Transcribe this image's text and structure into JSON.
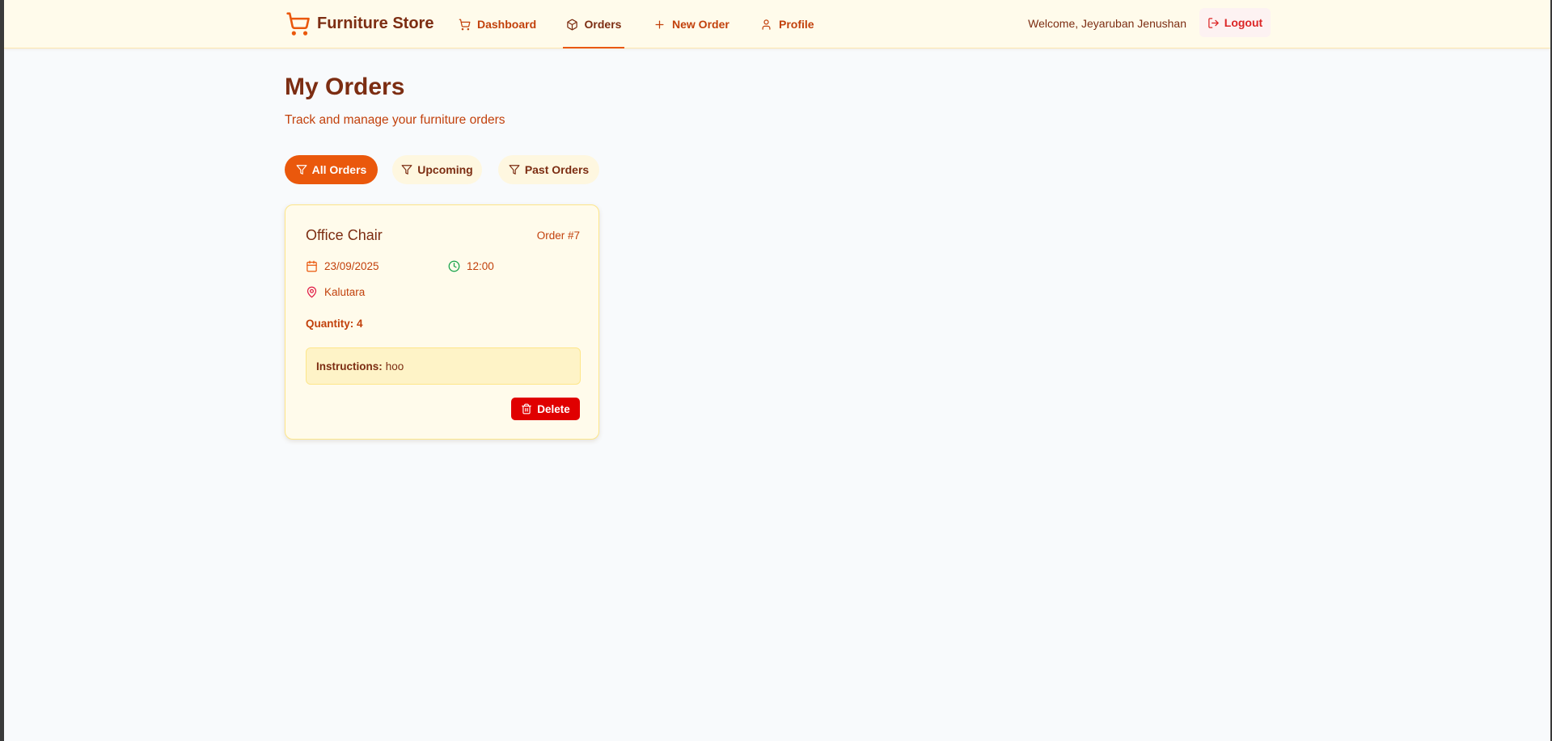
{
  "navbar": {
    "brand": "Furniture Store",
    "links": [
      {
        "label": "Dashboard",
        "icon": "cart-icon"
      },
      {
        "label": "Orders",
        "icon": "package-icon",
        "active": true
      },
      {
        "label": "New Order",
        "icon": "plus-icon"
      },
      {
        "label": "Profile",
        "icon": "user-icon"
      }
    ],
    "welcome": "Welcome, Jeyaruban Jenushan",
    "logout_label": "Logout"
  },
  "main": {
    "title": "My Orders",
    "subtitle": "Track and manage your furniture orders",
    "filters": [
      {
        "label": "All Orders",
        "active": true
      },
      {
        "label": "Upcoming",
        "active": false
      },
      {
        "label": "Past Orders",
        "active": false
      }
    ]
  },
  "orders": [
    {
      "name": "Office Chair",
      "order_no": "Order #7",
      "date": "23/09/2025",
      "time": "12:00",
      "location": "Kalutara",
      "quantity": "Quantity: 4",
      "instructions_label": "Instructions:",
      "instructions": "hoo",
      "delete_label": "Delete"
    }
  ],
  "colors": {
    "accent": "#ea580c",
    "brand_text": "#7c2d12",
    "link_text": "#c2410c",
    "delete": "#e00000",
    "logout": "#dc2626"
  }
}
